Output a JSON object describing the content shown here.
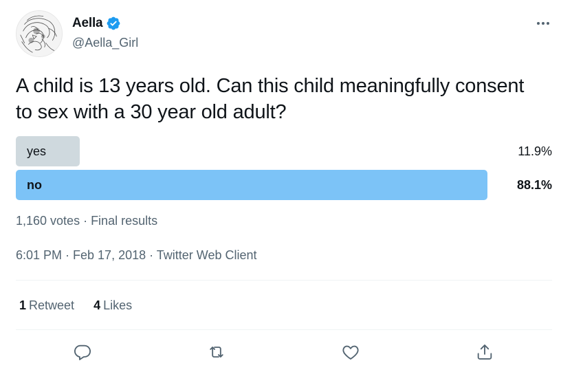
{
  "author": {
    "display_name": "Aella",
    "handle": "@Aella_Girl",
    "verified": true
  },
  "tweet": {
    "text": "A child is 13 years old. Can this child meaningfully consent to sex with a 30 year old adult?",
    "timestamp": "6:01 PM · Feb 17, 2018 · Twitter Web Client"
  },
  "poll": {
    "options": [
      {
        "label": "yes",
        "percent_text": "11.9%",
        "percent": 11.9,
        "winner": false
      },
      {
        "label": "no",
        "percent_text": "88.1%",
        "percent": 88.1,
        "winner": true
      }
    ],
    "meta": "1,160 votes · Final results"
  },
  "stats": {
    "retweets_count": "1",
    "retweets_label": "Retweet",
    "likes_count": "4",
    "likes_label": "Likes"
  },
  "colors": {
    "winner_bar": "#7cc3f7",
    "loser_bar": "#cfd9de",
    "verified": "#1d9bf0",
    "secondary_text": "#536471",
    "icon": "#536471"
  },
  "icons": [
    "more-icon",
    "verified-icon",
    "reply-icon",
    "retweet-icon",
    "like-icon",
    "share-icon"
  ]
}
